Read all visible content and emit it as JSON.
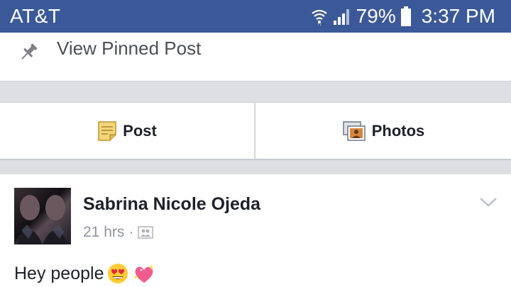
{
  "status_bar": {
    "carrier": "AT&T",
    "battery": "79%",
    "time": "3:37 PM",
    "icons": [
      "wifi-icon",
      "signal-icon",
      "battery-icon"
    ]
  },
  "pinned": {
    "label": "View Pinned Post",
    "icon": "pin-icon"
  },
  "composer_actions": [
    {
      "label": "Post",
      "icon": "note-icon"
    },
    {
      "label": "Photos",
      "icon": "photos-icon"
    }
  ],
  "feed_post": {
    "author": "Sabrina Nicole Ojeda",
    "time": "21 hrs",
    "separator": "·",
    "privacy_icon": "friends-icon",
    "text": "Hey people",
    "emojis": [
      "heart-eyes-emoji",
      "sparkling-heart-emoji"
    ]
  },
  "colors": {
    "brand": "#3b5998",
    "text": "#1d2129",
    "secondary": "#90949c",
    "separator": "#dddfe2"
  }
}
